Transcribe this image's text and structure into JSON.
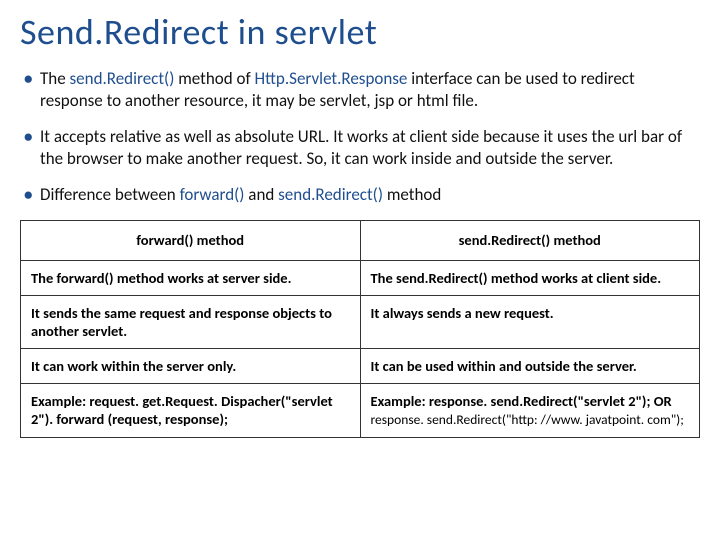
{
  "title": "Send.Redirect in servlet",
  "bullets": {
    "b1_pre": "The ",
    "b1_m1": "send.Redirect()",
    "b1_mid1": " method of ",
    "b1_m2": "Http.Servlet.Response",
    "b1_post": " interface can be used to redirect response to another resource, it may be servlet, jsp or html file.",
    "b2": "It accepts relative as well as absolute URL. It works at client side because it uses the url bar of the browser to make another request. So, it can work inside and outside the server.",
    "b3_pre": "Difference between ",
    "b3_m1": "forward()",
    "b3_mid": " and ",
    "b3_m2": "send.Redirect()",
    "b3_post": " method"
  },
  "table": {
    "head": {
      "c1": "forward() method",
      "c2": "send.Redirect() method"
    },
    "rows": [
      {
        "c1": "The forward() method works at server side.",
        "c2": "The send.Redirect() method works at client side."
      },
      {
        "c1": "It sends the same request and response objects to another servlet.",
        "c2": "It always sends a new request."
      },
      {
        "c1": "It can work within the server only.",
        "c2": "It can be used within and outside the server."
      },
      {
        "c1": "Example: request. get.Request. Dispacher(\"servlet 2\"). forward (request, response);",
        "c2_main": "Example: response. send.Redirect(\"servlet 2\"); OR",
        "c2_note": "response. send.Redirect(\"http: //www. javatpoint. com\");"
      }
    ]
  }
}
